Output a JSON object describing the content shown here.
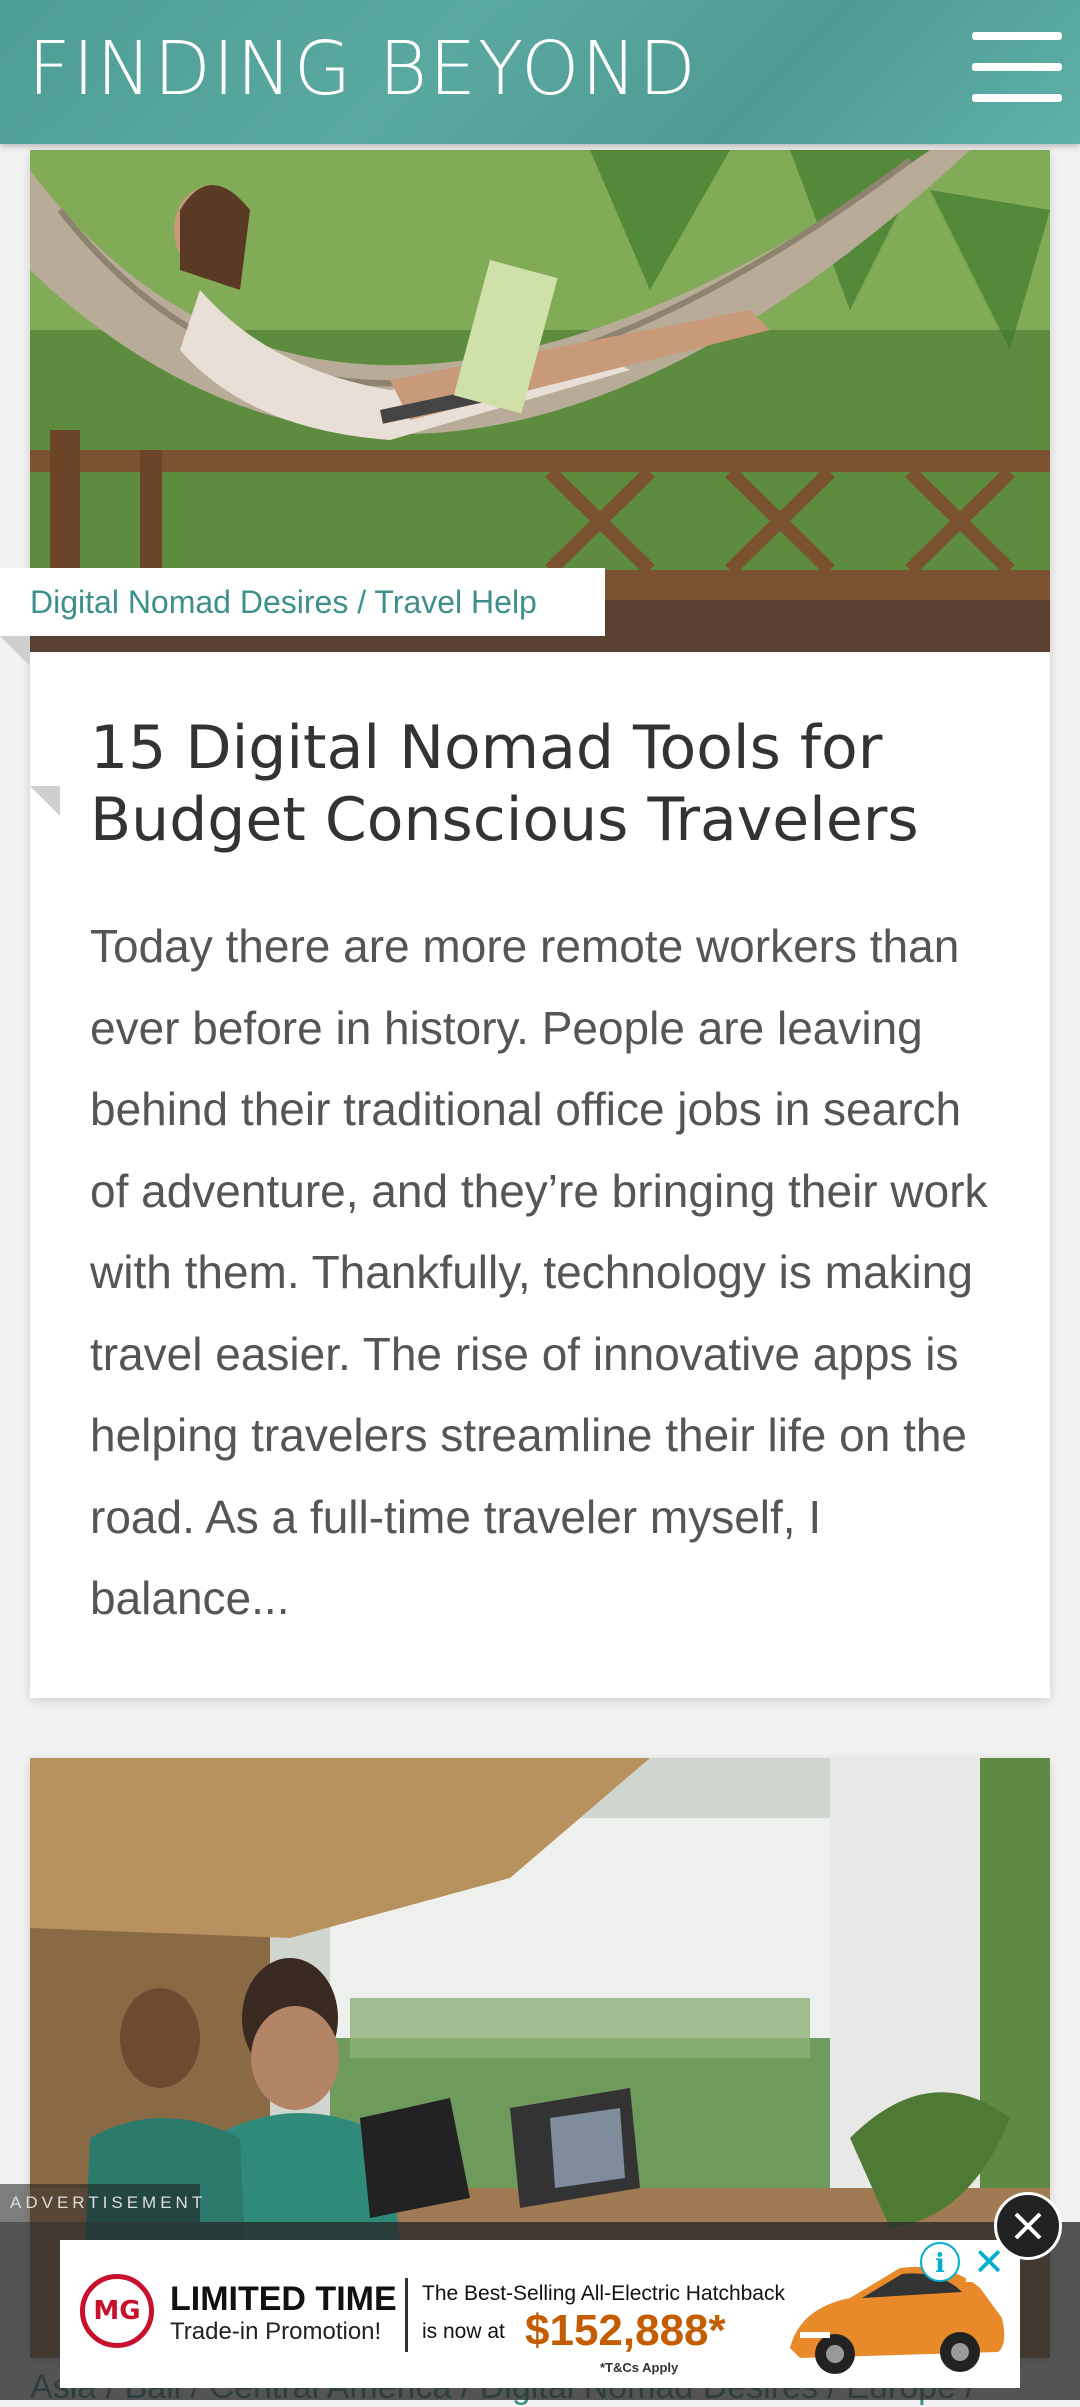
{
  "header": {
    "logo": "FINDING BEYOND",
    "menu_icon": "hamburger-menu-icon",
    "bg_color": "#58a49c"
  },
  "post1": {
    "categories": "Digital Nomad Desires / Travel Help",
    "title": "15 Digital Nomad Tools for Budget Conscious Travelers",
    "excerpt": "Today there are more remote workers than ever before in history. People are leaving behind their traditional office jobs in search of adventure, and they’re bringing their work with them. Thankfully, technology is making travel easier. The rise of innovative apps is helping travelers streamline their life on the road. As a full-time traveler myself, I balance..."
  },
  "post2": {
    "categories": "Asia / Bali / Central America / Digital Nomad Desires / Europe /"
  },
  "ad": {
    "label": "ADVERTISEMENT",
    "brand": "MG",
    "headline": "LIMITED TIME",
    "subline": "Trade-in Promotion!",
    "line1": "The Best-Selling All-Electric Hatchback",
    "line2": "is now at",
    "price": "$152,888*",
    "terms": "*T&Cs Apply",
    "info_icon": "info-icon",
    "close_icon": "close-icon"
  },
  "colors": {
    "accent": "#3d8f8a",
    "title": "#333333",
    "body": "#555555"
  }
}
